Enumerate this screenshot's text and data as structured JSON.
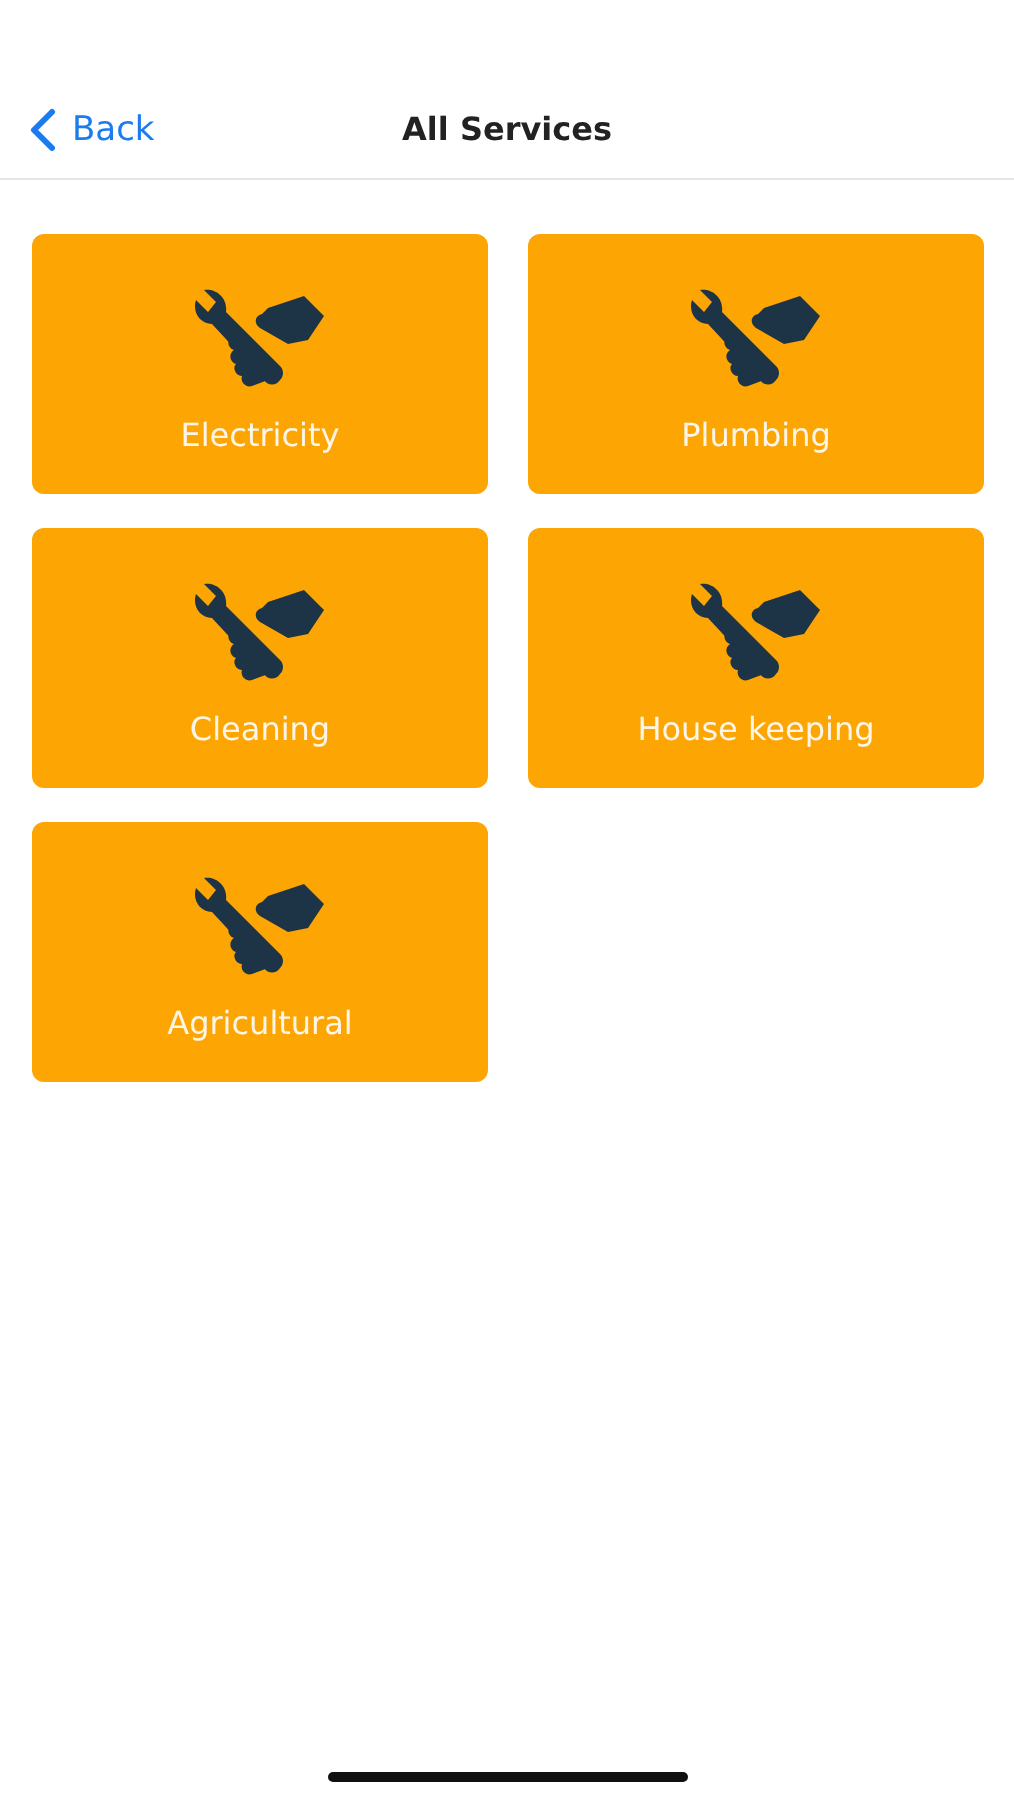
{
  "nav": {
    "back": "Back",
    "title": "All Services"
  },
  "services": [
    {
      "label": "Electricity"
    },
    {
      "label": "Plumbing"
    },
    {
      "label": "Cleaning"
    },
    {
      "label": "House keeping"
    },
    {
      "label": "Agricultural"
    }
  ]
}
